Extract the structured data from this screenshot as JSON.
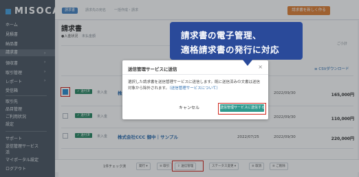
{
  "colors": {
    "sidebar_bg": "#505b66",
    "accent_blue": "#4a86c5",
    "new_button": "#e0833a",
    "status_green": "#2e8a66",
    "send_button": "#2e9a8e",
    "callout_bg": "#2a4a9a",
    "highlight_red": "#d0281f"
  },
  "sidebar": {
    "logo": "MISOCA",
    "items": [
      {
        "label": "ホーム"
      },
      {
        "label": "見積書"
      },
      {
        "label": "納品書"
      },
      {
        "label": "請求書",
        "active": true
      },
      {
        "label": "領収書"
      },
      {
        "label": "取引管理"
      },
      {
        "label": "レポート"
      },
      {
        "label": "受信箱"
      },
      {
        "label": "取引先"
      },
      {
        "label": "品目管理"
      },
      {
        "label": "ご利用状況"
      },
      {
        "label": "設定"
      },
      {
        "label": "サポート"
      },
      {
        "label": "送信管理サービス"
      },
      {
        "label": "活"
      },
      {
        "label": "マイポータル設定"
      },
      {
        "label": "ログアウト"
      }
    ]
  },
  "topbar": {
    "chips": [
      "請求書",
      "請求先の宛名",
      "一括作成・請求"
    ],
    "new_button": "請求書を新しく作る"
  },
  "main": {
    "title": "請求書",
    "filter_label": "●入金状況",
    "filter_value": "未払金額",
    "csv_link": "≡ CSVダウンロード",
    "right_hint": "ご小計",
    "rows": [
      {
        "status": "✓ 送付済",
        "sub": "未入金",
        "name": "株式会社",
        "date": "2022/09/30",
        "amount": "165,000円",
        "checked": true
      },
      {
        "status": "✓ 送付済",
        "sub": "未入金",
        "name": "",
        "date": "2022/09/30",
        "amount": "110,000円",
        "checked": false
      },
      {
        "status": "✓ 送付済",
        "sub": "未入金",
        "name": "株式会社CCC 御中｜サンプル",
        "date": "2022/07/25",
        "date2": "2022/09/30",
        "amount": "220,000円",
        "checked": false
      }
    ]
  },
  "bottom_bar": {
    "selection_count": "1件チェック済",
    "buttons": [
      "発行 ▾",
      "≡ 取引",
      "⇪ 送信管理",
      "ステータス変更 ▾",
      "≡ 取消",
      "≡ ご削除"
    ]
  },
  "modal": {
    "title": "送信管理サービスに送信",
    "body": "選択した請求書を送信管理サービスに送信します。既に送信済みの文書は送信対象から除外されます。",
    "link": "（送信管理サービスについて）",
    "cancel": "キャンセル",
    "submit": "送信管理サービスに送信する"
  },
  "callout": {
    "line1": "請求書の電子管理、",
    "line2": "適格請求書の発行に対応"
  }
}
